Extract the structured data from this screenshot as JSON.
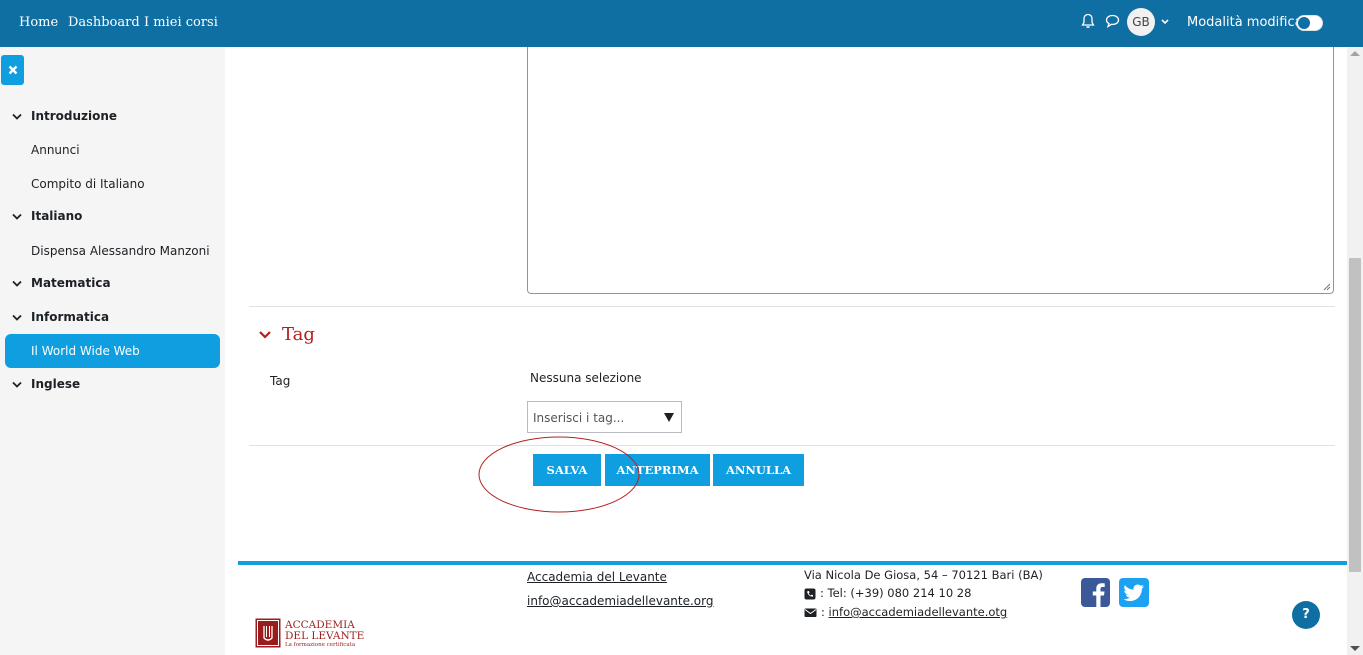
{
  "navbar": {
    "links": [
      "Home",
      "Dashboard",
      "I miei corsi"
    ],
    "avatar_initials": "GB",
    "edit_mode_label": "Modalità modifica",
    "icons": [
      "bell-icon",
      "chat-icon",
      "chevron-down-icon"
    ],
    "color": "#0f6fa3"
  },
  "sidebar": {
    "close_icon": "close-icon",
    "sections": [
      {
        "label": "Introduzione",
        "items": [
          "Annunci",
          "Compito di Italiano"
        ]
      },
      {
        "label": "Italiano",
        "items": [
          "Dispensa Alessandro Manzoni"
        ]
      },
      {
        "label": "Matematica",
        "items": []
      },
      {
        "label": "Informatica",
        "items": [
          "Il World Wide Web"
        ],
        "active_item": "Il World Wide Web"
      },
      {
        "label": "Inglese",
        "items": []
      }
    ],
    "accent": "#0f9ee0"
  },
  "form": {
    "tag_section_title": "Tag",
    "tag_label": "Tag",
    "no_selection": "Nessuna selezione",
    "tag_placeholder": "Inserisci i tag...",
    "buttons": {
      "save": "SALVA",
      "preview": "ANTEPRIMA",
      "cancel": "ANNULLA"
    }
  },
  "footer": {
    "link_name": "Accademia del Levante",
    "link_email": "info@accademiadellevante.org",
    "address": "Via Nicola De Giosa, 54 – 70121 Bari (BA)",
    "phone": ": Tel: (+39) 080 214 10 28",
    "email_prefix": ": ",
    "email": "info@accademiadellevante.otg",
    "logo_name_line1": "ACCADEMIA",
    "logo_name_line2": "DEL LEVANTE",
    "logo_tagline": "La formazione certificata",
    "help": "?"
  }
}
